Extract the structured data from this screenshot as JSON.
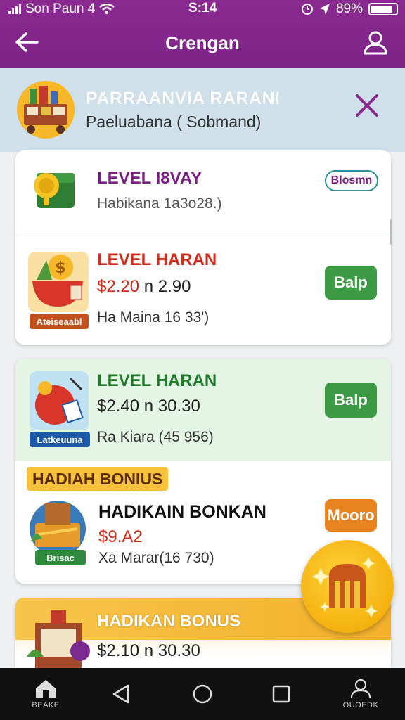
{
  "status_bar": {
    "carrier": "Son Paun 4",
    "time": "S:14",
    "battery": "89%",
    "battery_level": 0.89
  },
  "app_bar": {
    "title": "Crengan",
    "back_icon": "arrow-left-icon",
    "profile_icon": "user-icon"
  },
  "banner": {
    "title": "PARRAANVIA RARANI",
    "subtitle": "Paeluabana ( Sobmand)",
    "close_icon": "close-icon"
  },
  "cards": [
    {
      "title": "LEVEL I8VAY",
      "meta": "Habikana 1a3o28.)",
      "button": "Blosmn",
      "icon": "wallet-icon",
      "colors": {
        "title": "#7b1f87",
        "button_border": "#2c8f9c"
      }
    },
    {
      "title": "LEVEL HARAN",
      "price": "$2.20",
      "price_tail": " n 2.90",
      "meta": "Ha Maina 16 33')",
      "button": "Balp",
      "tag": "Ateiseaabl",
      "icon": "money-bag-icon",
      "colors": {
        "title": "#d32a1a",
        "button": "#3c9a45"
      }
    },
    {
      "title": "LEVEL HARAN",
      "price": "$2.40",
      "price_tail": " n 30.30",
      "meta": "Ra Kiara (45 956)",
      "button": "Balp",
      "tag": "Latkeuuna",
      "icon": "fruit-bag-icon",
      "colors": {
        "title": "#1f7a2a",
        "button": "#3c9a45"
      }
    },
    {
      "section_label": "HADIAH BONIUS",
      "title": "HADIKAIN BONKAN",
      "price": "$9.A2",
      "meta": "Xa Marar(16 730)",
      "button": "Mooro",
      "tag": "Brisac",
      "icon": "gift-box-icon",
      "colors": {
        "title": "#111111",
        "price": "#d32a1a",
        "button": "#e88420"
      }
    },
    {
      "title": "HADIKAN BONUS",
      "price": "$2.10",
      "price_tail": " n 30.30",
      "icon": "gift-icon"
    }
  ],
  "fab": {
    "icon": "reward-gate-icon"
  },
  "nav": {
    "home_label": "BEAKE",
    "profile_label": "OUOEDK",
    "home_icon": "home-icon",
    "back_icon": "triangle-back-icon",
    "circle_icon": "circle-home-icon",
    "square_icon": "square-recent-icon",
    "profile_icon": "person-icon"
  },
  "colors": {
    "app_bar": "#7c2386",
    "banner": "#cfe0eb",
    "green_card": "#e4f5e6",
    "bonus_label": "#f6c23b"
  }
}
